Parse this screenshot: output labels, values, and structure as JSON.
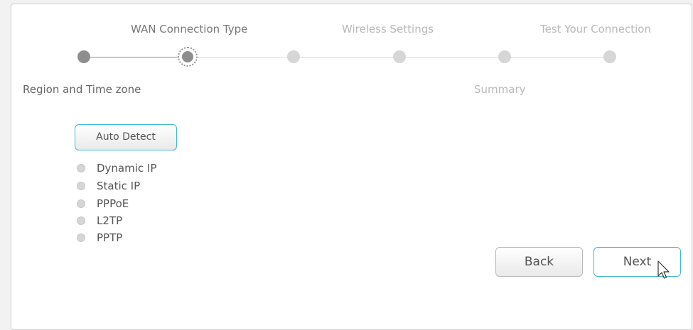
{
  "wizard": {
    "steps_top": [
      {
        "label": "WAN Connection Type",
        "state": "active"
      },
      {
        "label": "Wireless Settings",
        "state": "inactive"
      },
      {
        "label": "Test Your Connection",
        "state": "inactive"
      }
    ],
    "steps_bottom": [
      {
        "label": "Region and Time zone",
        "state": "done"
      },
      {
        "label": "Summary",
        "state": "inactive"
      }
    ],
    "current_step": 2,
    "total_steps": 6
  },
  "auto_detect": {
    "label": "Auto Detect"
  },
  "connection_types": [
    {
      "label": "Dynamic IP",
      "selected": false
    },
    {
      "label": "Static IP",
      "selected": false
    },
    {
      "label": "PPPoE",
      "selected": false
    },
    {
      "label": "L2TP",
      "selected": false
    },
    {
      "label": "PPTP",
      "selected": false
    }
  ],
  "nav": {
    "back_label": "Back",
    "next_label": "Next"
  },
  "colors": {
    "accent": "#3fb6d6",
    "done_node": "#8e8e8e",
    "pending_node": "#d6d6d6"
  }
}
